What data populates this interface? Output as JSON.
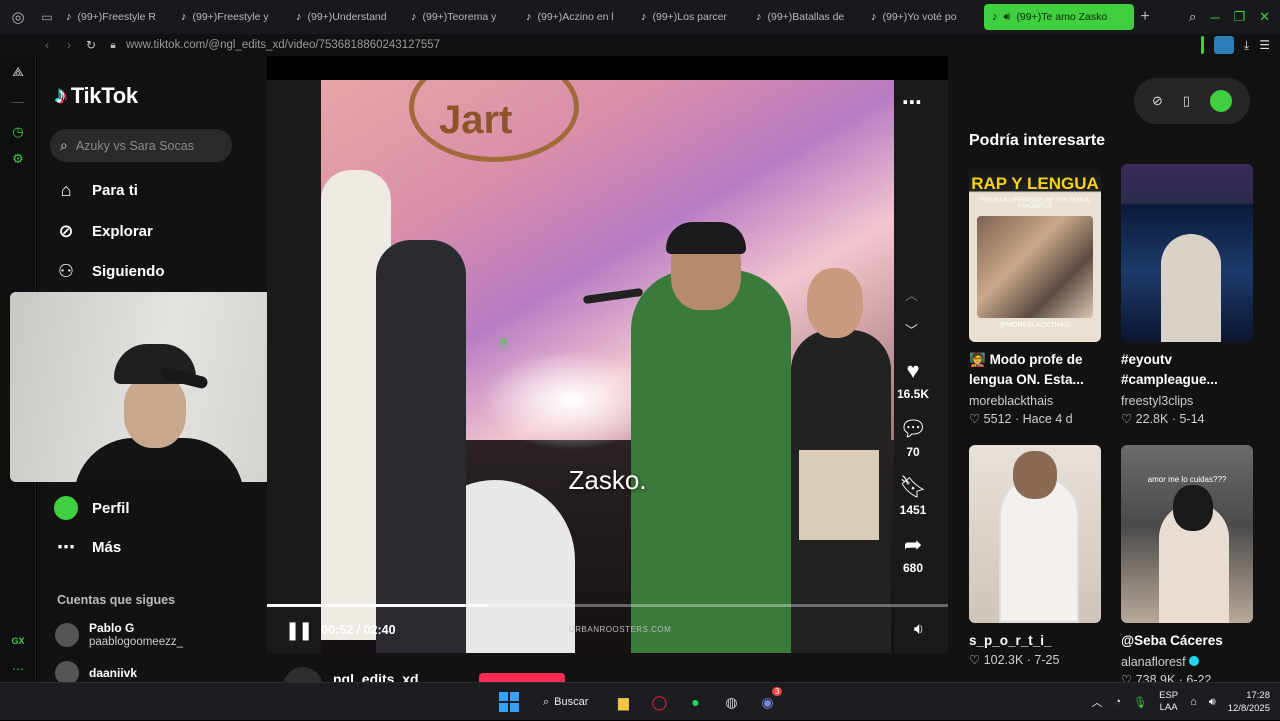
{
  "browser": {
    "tabs": [
      {
        "label": "(99+)Freestyle R"
      },
      {
        "label": "(99+)Freestyle y"
      },
      {
        "label": "(99+)Understand"
      },
      {
        "label": "(99+)Teorema y"
      },
      {
        "label": "(99+)Aczino en l"
      },
      {
        "label": "(99+)Los parcer"
      },
      {
        "label": "(99+)Batallas de"
      },
      {
        "label": "(99+)Yo voté po"
      },
      {
        "label": "(99+)Te amo Zasko",
        "active": true
      }
    ],
    "url": "www.tiktok.com/@ngl_edits_xd/video/7536818860243127557",
    "accent_color": "#3fcf3f"
  },
  "tiktok_nav": {
    "logo": "TikTok",
    "search_placeholder": "Azuky vs Sara Socas",
    "items": [
      {
        "label": "Para ti",
        "icon": "home-icon"
      },
      {
        "label": "Explorar",
        "icon": "compass-icon"
      },
      {
        "label": "Siguiendo",
        "icon": "following-icon"
      },
      {
        "label": "Perfil",
        "icon": "profile-avatar"
      },
      {
        "label": "Más",
        "icon": "more-icon"
      }
    ],
    "following_heading": "Cuentas que sigues",
    "following": [
      {
        "name": "Pablo G",
        "handle": "paablogoomeezz_"
      },
      {
        "name": "daaniivk",
        "handle": ""
      }
    ]
  },
  "player": {
    "caption": "Zasko.",
    "watermark": "URBANROOSTERS.COM",
    "likes": "16.5K",
    "comments": "70",
    "saves": "1451",
    "shares": "680",
    "time": "00:52 / 02:40",
    "progress": 0.325,
    "author": "ngl_edits_xd"
  },
  "recommendations": {
    "title": "Podría interesarte",
    "cards": [
      {
        "thumb_header": "RAP Y LENGUA",
        "thumb_sub": "FIGURAS LITERARIAS DE TUS TEMAS FAVORITOS",
        "thumb_tag": "@MOREBLACKTHAIS",
        "cap1": "Modo profe de",
        "cap2": "lengua ON. Esta...",
        "author": "moreblackthais",
        "stats": "♡ 5512 · Hace 4 d"
      },
      {
        "cap1": "#eyoutv",
        "cap2": "#campleague...",
        "author": "freestyl3clips",
        "stats": "♡ 22.8K · 5-14"
      },
      {
        "cap1": "s_p_o_r_t_i_",
        "cap2": "",
        "author": "",
        "stats": "♡ 102.3K · 7-25"
      },
      {
        "thumb_text": "amor me lo cuidas???",
        "cap1": "@Seba Cáceres",
        "cap2": "",
        "author": "alanafloresf",
        "stats": "♡ 738.9K · 6-22"
      }
    ]
  },
  "taskbar": {
    "search_label": "Buscar",
    "lang_top": "ESP",
    "lang_bottom": "LAA",
    "time": "17:28",
    "date": "12/8/2025",
    "discord_badge": "3"
  }
}
